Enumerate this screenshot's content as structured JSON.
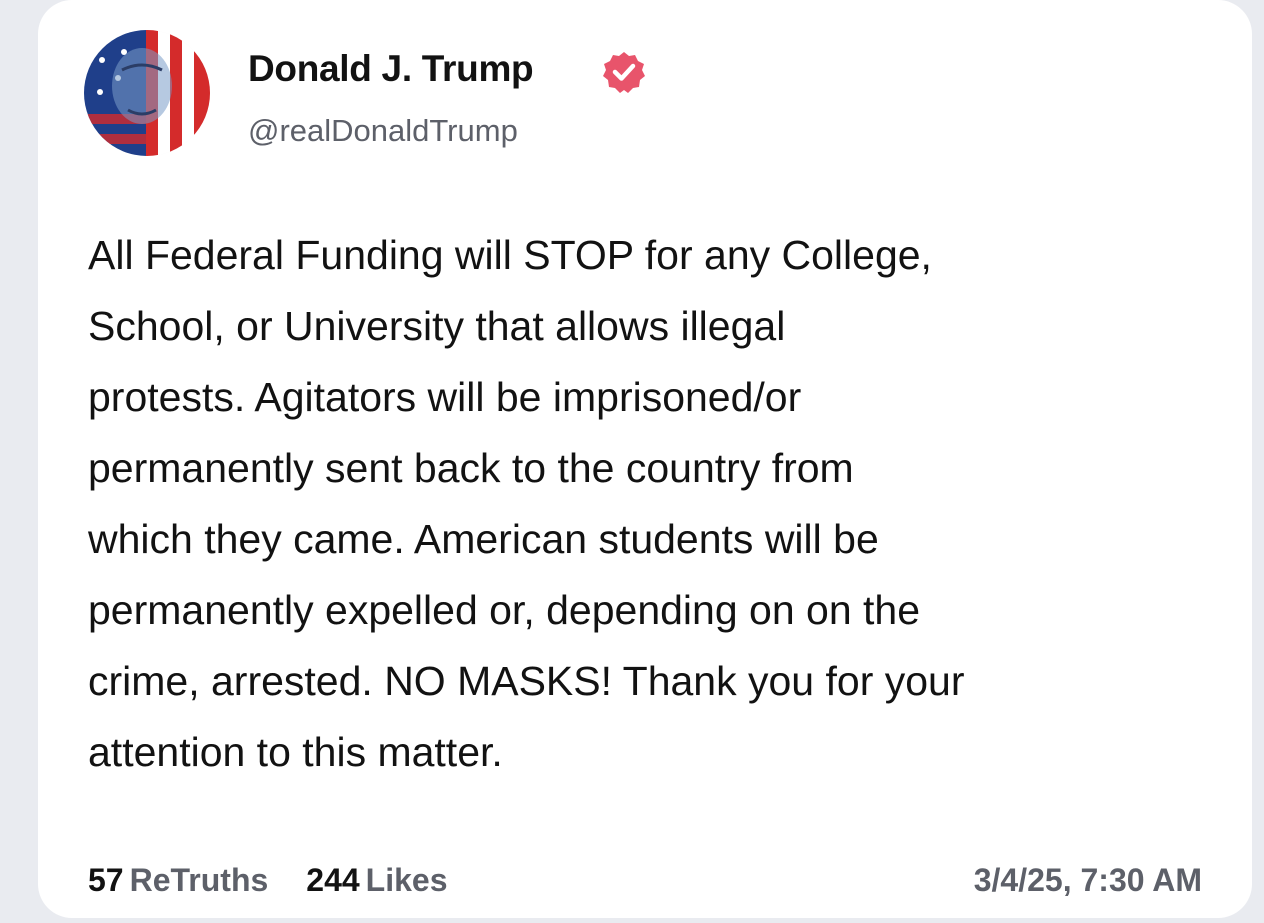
{
  "colors": {
    "verified_badge": "#e8546b",
    "muted_text": "#5d6069",
    "body_text": "#121212"
  },
  "author": {
    "display_name": "Donald J. Trump",
    "handle": "@realDonaldTrump",
    "verified_icon": "verified-badge-icon",
    "avatar_icon": "profile-avatar"
  },
  "post": {
    "lines": [
      "All Federal Funding will STOP for any College,",
      "School, or University that allows illegal",
      "protests. Agitators will be imprisoned/or",
      "permanently sent back to the country from",
      "which they came. American students will be",
      "permanently expelled or, depending on on the",
      "crime, arrested. NO MASKS! Thank you for your",
      "attention to this matter."
    ]
  },
  "stats": {
    "retruths_count": "57",
    "retruths_label": "ReTruths",
    "likes_count": "244",
    "likes_label": "Likes"
  },
  "timestamp": "3/4/25, 7:30 AM"
}
